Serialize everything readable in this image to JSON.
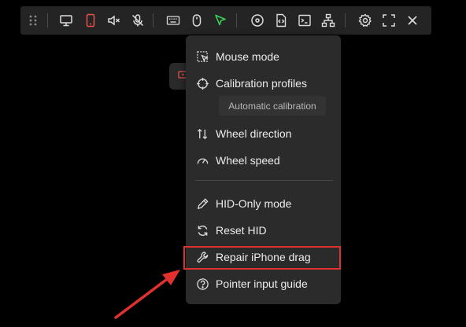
{
  "toolbar": {
    "buttons": [
      {
        "name": "drag-handle-icon"
      },
      {
        "name": "monitor-icon"
      },
      {
        "name": "phone-icon",
        "color": "#e5534b"
      },
      {
        "name": "speaker-mute-icon"
      },
      {
        "name": "microphone-off-icon"
      },
      {
        "name": "keyboard-icon"
      },
      {
        "name": "mouse-icon"
      },
      {
        "name": "pointer-icon",
        "color": "#3ccf5a"
      },
      {
        "name": "disc-icon"
      },
      {
        "name": "code-file-icon"
      },
      {
        "name": "terminal-icon"
      },
      {
        "name": "network-icon"
      },
      {
        "name": "gear-icon"
      },
      {
        "name": "fullscreen-icon"
      },
      {
        "name": "close-icon"
      }
    ]
  },
  "menu": {
    "items": [
      {
        "label": "Mouse mode",
        "icon": "mouse-mode-icon"
      },
      {
        "label": "Calibration profiles",
        "icon": "crosshair-icon"
      },
      {
        "label": "Wheel direction",
        "icon": "arrows-updown-icon"
      },
      {
        "label": "Wheel speed",
        "icon": "gauge-icon"
      },
      {
        "label": "HID-Only mode",
        "icon": "pencil-icon"
      },
      {
        "label": "Reset HID",
        "icon": "refresh-icon"
      },
      {
        "label": "Repair iPhone drag",
        "icon": "wrench-icon"
      },
      {
        "label": "Pointer input guide",
        "icon": "question-circle-icon"
      }
    ],
    "tooltip": "Automatic calibration"
  },
  "annotation": {
    "highlight_color": "#e0312f"
  }
}
